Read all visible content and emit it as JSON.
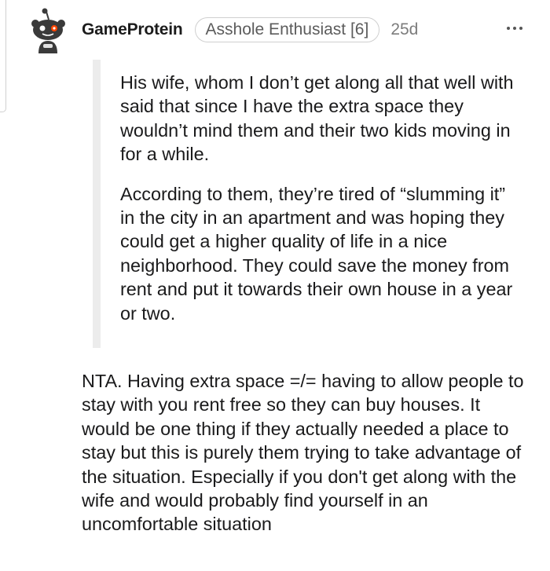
{
  "comment": {
    "author": "GameProtein",
    "flair": "Asshole Enthusiast [6]",
    "age": "25d",
    "more_icon": "ellipsis-icon",
    "avatar_icon": "snoo-avatar-icon",
    "quote_paragraphs": [
      "His wife, whom I don’t get along all that well with said that since I have the extra space they wouldn’t mind them and their two kids moving in for a while.",
      "According to them, they’re tired of “slumming it” in the city in an apartment and was hoping they could get a higher quality of life in a nice neighborhood. They could save the money from rent and put it towards their own house in a year or two."
    ],
    "body": "NTA. Having extra space =/= having to allow people to stay with you rent free so they can buy houses. It would be one thing if they actually needed a place to stay but this is purely them trying to take advantage of the situation. Especially if you don't get along with the wife and would probably find yourself in an uncomfortable situation"
  },
  "colors": {
    "text": "#1a1a1b",
    "meta": "#7c7c7c",
    "flair_border": "#cfcfcf",
    "quote_bar": "#ececec",
    "avatar_body": "#3a3a3a",
    "avatar_eye": "#ff4500"
  }
}
